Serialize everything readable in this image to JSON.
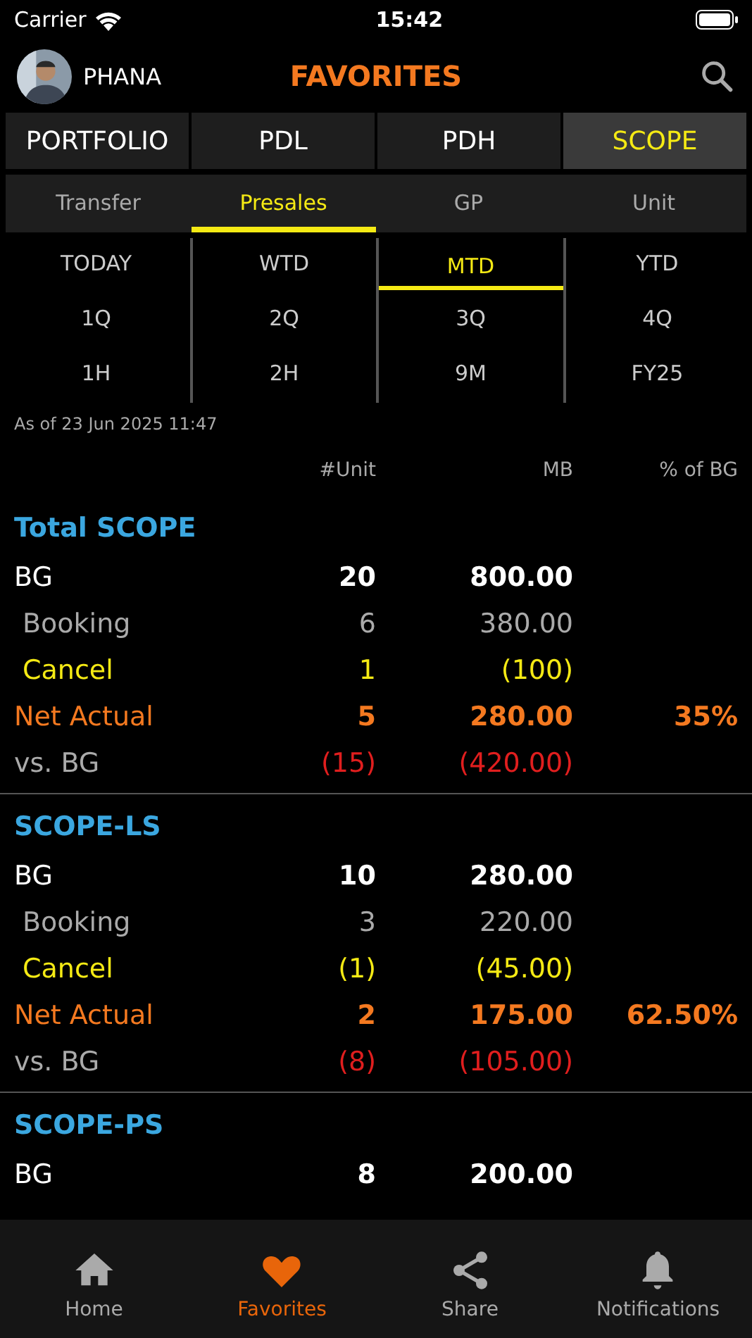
{
  "status_bar": {
    "carrier": "Carrier",
    "time": "15:42"
  },
  "header": {
    "user": "PHANA",
    "title": "FAVORITES"
  },
  "tabs": [
    {
      "label": "PORTFOLIO",
      "selected": false
    },
    {
      "label": "PDL",
      "selected": false
    },
    {
      "label": "PDH",
      "selected": false
    },
    {
      "label": "SCOPE",
      "selected": true
    }
  ],
  "subtabs": [
    {
      "label": "Transfer",
      "selected": false
    },
    {
      "label": "Presales",
      "selected": true
    },
    {
      "label": "GP",
      "selected": false
    },
    {
      "label": "Unit",
      "selected": false
    }
  ],
  "periods": [
    {
      "label": "TODAY",
      "selected": false
    },
    {
      "label": "WTD",
      "selected": false
    },
    {
      "label": "MTD",
      "selected": true
    },
    {
      "label": "YTD",
      "selected": false
    },
    {
      "label": "1Q",
      "selected": false
    },
    {
      "label": "2Q",
      "selected": false
    },
    {
      "label": "3Q",
      "selected": false
    },
    {
      "label": "4Q",
      "selected": false
    },
    {
      "label": "1H",
      "selected": false
    },
    {
      "label": "2H",
      "selected": false
    },
    {
      "label": "9M",
      "selected": false
    },
    {
      "label": "FY25",
      "selected": false
    }
  ],
  "as_of": "As of 23 Jun 2025 11:47",
  "columns": [
    "#Unit",
    "MB",
    "% of BG"
  ],
  "sections": [
    {
      "title": "Total SCOPE",
      "rows": [
        {
          "kind": "bg",
          "label": "BG",
          "unit": "20",
          "mb": "800.00"
        },
        {
          "kind": "booking",
          "label": "Booking",
          "unit": "6",
          "mb": "380.00"
        },
        {
          "kind": "cancel",
          "label": "Cancel",
          "unit": "1",
          "mb": "(100)"
        },
        {
          "kind": "net",
          "label": "Net Actual",
          "unit": "5",
          "mb": "280.00",
          "pct": "35%"
        },
        {
          "kind": "vs",
          "label": "vs. BG",
          "unit": "(15)",
          "mb": "(420.00)"
        }
      ]
    },
    {
      "title": "SCOPE-LS",
      "rows": [
        {
          "kind": "bg",
          "label": "BG",
          "unit": "10",
          "mb": "280.00"
        },
        {
          "kind": "booking",
          "label": "Booking",
          "unit": "3",
          "mb": "220.00"
        },
        {
          "kind": "cancel",
          "label": "Cancel",
          "unit": "(1)",
          "mb": "(45.00)"
        },
        {
          "kind": "net",
          "label": "Net Actual",
          "unit": "2",
          "mb": "175.00",
          "pct": "62.50%"
        },
        {
          "kind": "vs",
          "label": "vs. BG",
          "unit": "(8)",
          "mb": "(105.00)"
        }
      ]
    },
    {
      "title": "SCOPE-PS",
      "rows": [
        {
          "kind": "bg",
          "label": "BG",
          "unit": "8",
          "mb": "200.00"
        }
      ]
    }
  ],
  "tab_bar": [
    {
      "label": "Home",
      "selected": false
    },
    {
      "label": "Favorites",
      "selected": true
    },
    {
      "label": "Share",
      "selected": false
    },
    {
      "label": "Notifications",
      "selected": false
    }
  ]
}
